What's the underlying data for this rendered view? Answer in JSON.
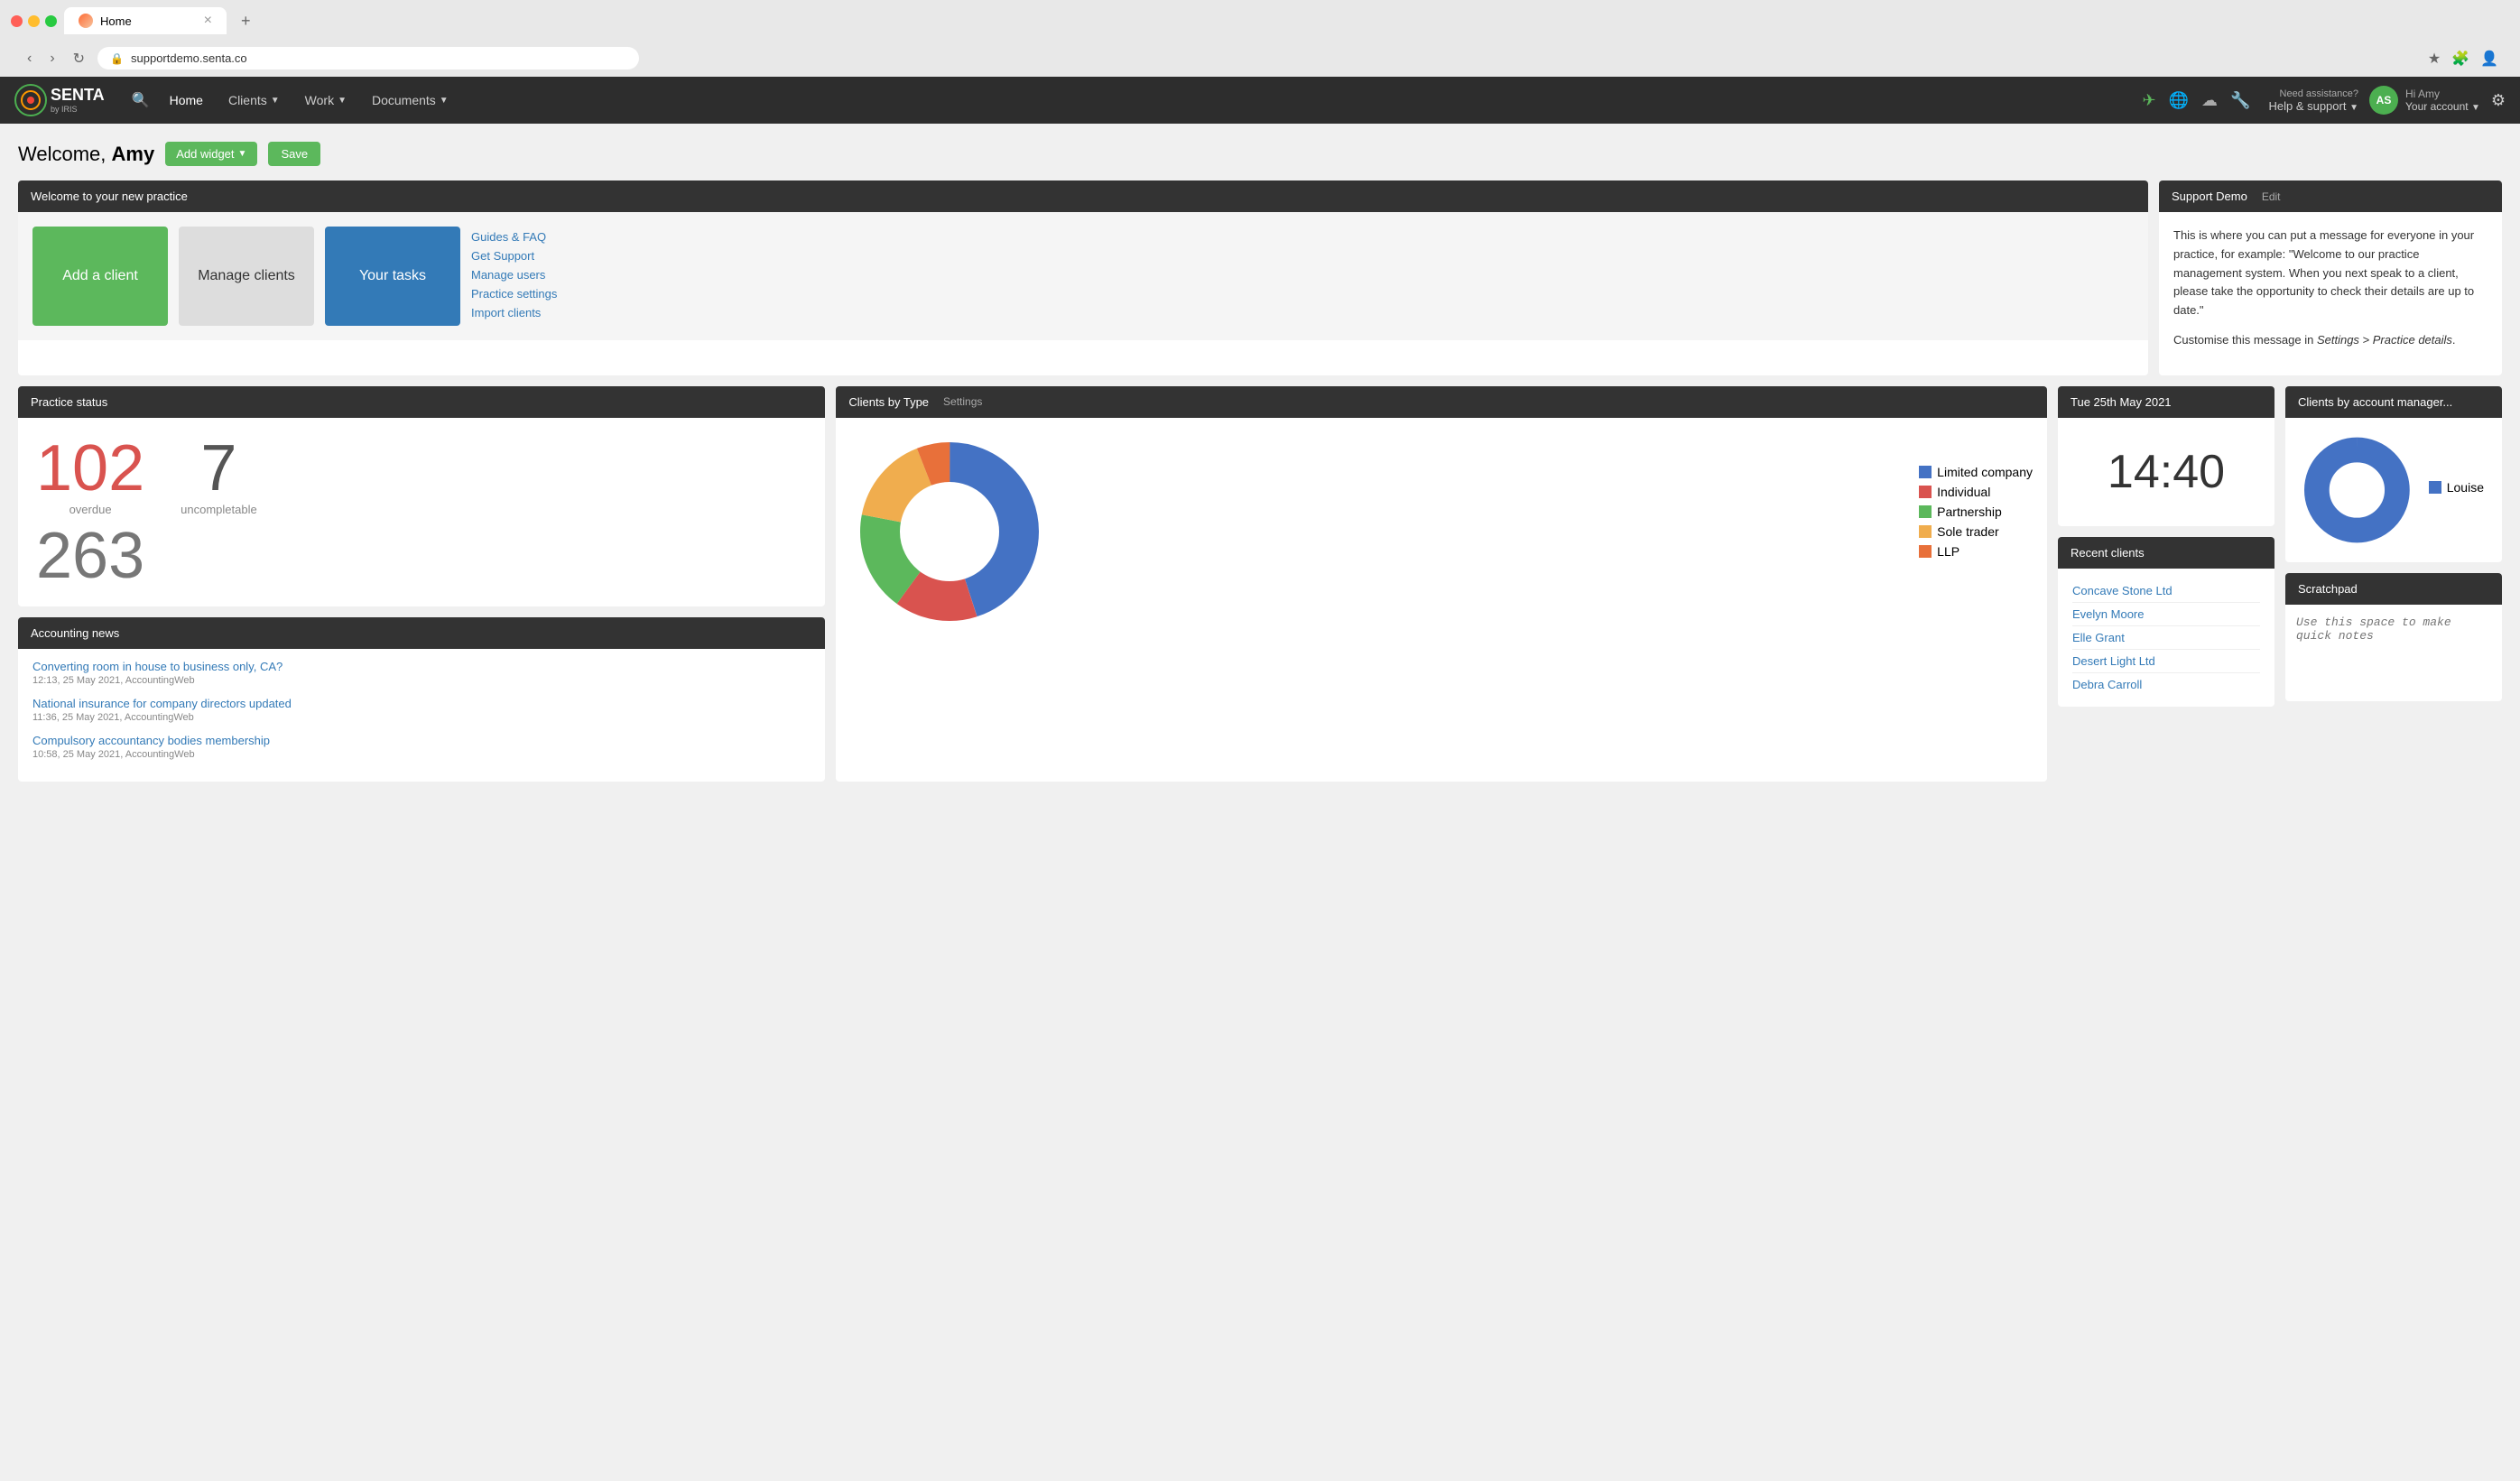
{
  "browser": {
    "tab_title": "Home",
    "address": "supportdemo.senta.co",
    "new_tab_label": "+"
  },
  "navbar": {
    "logo_text": "SENTA",
    "logo_sub": "by IRIS",
    "nav_home": "Home",
    "nav_clients": "Clients",
    "nav_work": "Work",
    "nav_documents": "Documents",
    "help_small": "Need assistance?",
    "help_main": "Help & support",
    "account_hi": "Hi Amy",
    "account_sub": "Your account",
    "avatar_initials": "AS"
  },
  "page": {
    "title_prefix": "Welcome, ",
    "title_name": "Amy",
    "add_widget_label": "Add widget",
    "save_label": "Save"
  },
  "welcome_widget": {
    "header": "Welcome to your new practice",
    "add_client_label": "Add a client",
    "manage_clients_label": "Manage clients",
    "your_tasks_label": "Your tasks",
    "links": [
      "Guides & FAQ",
      "Get Support",
      "Manage users",
      "Practice settings",
      "Import clients"
    ]
  },
  "support_demo": {
    "header": "Support Demo",
    "edit_label": "Edit",
    "para1": "This is where you can put a message for everyone in your practice, for example: \"Welcome to our practice management system.  When you next speak to a client, please take the opportunity to check their details are up to date.\"",
    "para2": "Customise this message in Settings > Practice details."
  },
  "practice_status": {
    "header": "Practice status",
    "overdue_number": "102",
    "overdue_label": "overdue",
    "uncompletable_number": "7",
    "uncompletable_label": "uncompletable",
    "partial_number": "263"
  },
  "clients_by_type": {
    "header": "Clients by Type",
    "settings_label": "Settings",
    "legend": [
      {
        "label": "Limited company",
        "color": "#4472C4"
      },
      {
        "label": "Individual",
        "color": "#d9534f"
      },
      {
        "label": "Partnership",
        "color": "#5cb85c"
      },
      {
        "label": "Sole trader",
        "color": "#f0ad4e"
      },
      {
        "label": "LLP",
        "color": "#e8703a"
      }
    ],
    "segments": [
      {
        "label": "Limited company",
        "color": "#4472C4",
        "pct": 45
      },
      {
        "label": "Individual",
        "color": "#d9534f",
        "pct": 15
      },
      {
        "label": "Partnership",
        "color": "#5cb85c",
        "pct": 18
      },
      {
        "label": "Sole trader",
        "color": "#f0ad4e",
        "pct": 16
      },
      {
        "label": "LLP",
        "color": "#e8703a",
        "pct": 6
      }
    ]
  },
  "clock": {
    "date": "Tue 25th May 2021",
    "time": "14:40"
  },
  "account_manager": {
    "header": "Clients by account manager...",
    "legend_name": "Louise",
    "legend_color": "#4472C4"
  },
  "accounting_news": {
    "header": "Accounting news",
    "items": [
      {
        "title": "Converting room in house to business only, CA?",
        "meta": "12:13, 25 May 2021, AccountingWeb"
      },
      {
        "title": "National insurance for company directors updated",
        "meta": "11:36, 25 May 2021, AccountingWeb"
      },
      {
        "title": "Compulsory accountancy bodies membership",
        "meta": "10:58, 25 May 2021, AccountingWeb"
      }
    ]
  },
  "recent_clients": {
    "header": "Recent clients",
    "clients": [
      "Concave Stone Ltd",
      "Evelyn Moore",
      "Elle Grant",
      "Desert Light Ltd",
      "Debra Carroll"
    ]
  },
  "scratchpad": {
    "header": "Scratchpad",
    "placeholder": "Use this space to make quick notes"
  }
}
